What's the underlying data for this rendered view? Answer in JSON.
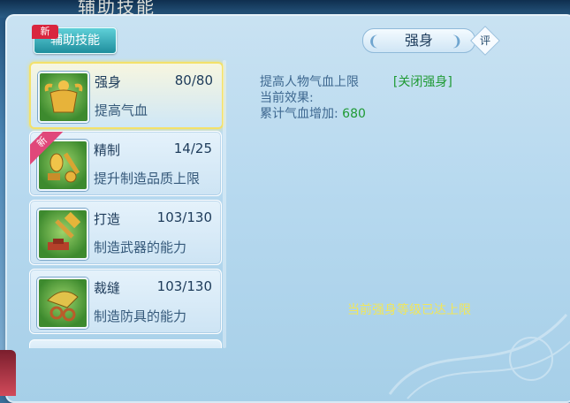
{
  "window": {
    "title": "辅助技能"
  },
  "tab": {
    "label": "辅助技能",
    "badge": "新"
  },
  "skills": [
    {
      "name": "强身",
      "level": "80/80",
      "desc": "提高气血",
      "selected": true,
      "badge": ""
    },
    {
      "name": "精制",
      "level": "14/25",
      "desc": "提升制造品质上限",
      "selected": false,
      "badge": "新"
    },
    {
      "name": "打造",
      "level": "103/130",
      "desc": "制造武器的能力",
      "selected": false,
      "badge": ""
    },
    {
      "name": "裁缝",
      "level": "103/130",
      "desc": "制造防具的能力",
      "selected": false,
      "badge": ""
    }
  ],
  "detail": {
    "title": "强身",
    "rate_label": "评",
    "line1": "提高人物气血上限",
    "toggle_link": "[关闭强身]",
    "line2": "当前效果:",
    "line3_label": "累计气血增加:",
    "line3_value": "680",
    "max_message": "当前强身等级已达上限"
  },
  "colors": {
    "accent_green": "#1f9a34",
    "max_message": "#f1e65a",
    "selected_border": "#f3e16a"
  },
  "icons": [
    "muscle-icon",
    "refine-tools-icon",
    "hammer-anvil-icon",
    "sewing-icon"
  ]
}
